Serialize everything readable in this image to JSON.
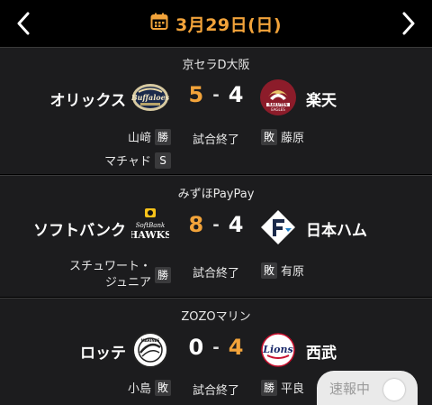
{
  "header": {
    "date": "3月29日(日)",
    "prev_icon": "chevron-left-icon",
    "next_icon": "chevron-right-icon",
    "calendar_icon": "calendar-icon",
    "accent": "#f2a33a"
  },
  "games": [
    {
      "venue": "京セラD大阪",
      "home": "オリックス",
      "away": "楽天",
      "home_score": "5",
      "away_score": "4",
      "home_logo": "buffaloes-logo",
      "away_logo": "rakuten-eagles-logo",
      "status": "試合終了",
      "left_pitcher": "山﨑",
      "left_badge": "勝",
      "right_pitcher": "藤原",
      "right_badge": "敗",
      "save_pitcher": "マチャド",
      "save_badge": "S"
    },
    {
      "venue": "みずほPayPay",
      "home": "ソフトバンク",
      "away": "日本ハム",
      "home_score": "8",
      "away_score": "4",
      "home_logo": "hawks-logo",
      "away_logo": "fighters-logo",
      "status": "試合終了",
      "left_pitcher_line1": "スチュワート・",
      "left_pitcher_line2": "ジュニア",
      "left_badge": "勝",
      "right_pitcher": "有原",
      "right_badge": "敗"
    },
    {
      "venue": "ZOZOマリン",
      "home": "ロッテ",
      "away": "西武",
      "home_score": "0",
      "away_score": "4",
      "home_logo": "marines-logo",
      "away_logo": "lions-logo",
      "status": "試合終了",
      "left_pitcher": "小島",
      "left_badge": "敗",
      "right_pitcher": "平良",
      "right_badge": "勝"
    }
  ],
  "live_toggle": {
    "label": "速報中",
    "on": false
  }
}
